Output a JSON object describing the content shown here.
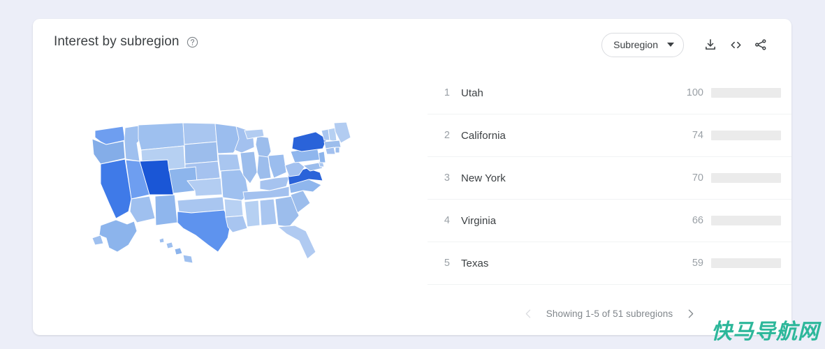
{
  "card": {
    "title": "Interest by subregion",
    "help_icon": "help-circle-icon"
  },
  "header": {
    "region_select_label": "Subregion",
    "caret_icon": "chevron-down-icon",
    "download_icon": "download-icon",
    "embed_icon": "embed-code-icon",
    "share_icon": "share-icon"
  },
  "colors": {
    "bar_fill": "#4e8cf0",
    "bar_track": "#ebebeb",
    "page_background": "#eceef8",
    "card_background": "#ffffff",
    "map_max": "#1a56d6",
    "map_min": "#c6d8f7",
    "watermark": "#2cb79a"
  },
  "chart_data": {
    "type": "bar",
    "title": "Interest by subregion",
    "xlabel": "",
    "ylabel": "",
    "ylim": [
      0,
      100
    ],
    "categories": [
      "Utah",
      "California",
      "New York",
      "Virginia",
      "Texas"
    ],
    "values": [
      100,
      74,
      70,
      66,
      59
    ],
    "ranks": [
      1,
      2,
      3,
      4,
      5
    ],
    "grid": false,
    "legend": "none",
    "note": "Horizontal ranked bar list, values normalized 0-100"
  },
  "list": {
    "rows": [
      {
        "rank": "1",
        "name": "Utah",
        "value": "100",
        "pct": 100
      },
      {
        "rank": "2",
        "name": "California",
        "value": "74",
        "pct": 74
      },
      {
        "rank": "3",
        "name": "New York",
        "value": "70",
        "pct": 70
      },
      {
        "rank": "4",
        "name": "Virginia",
        "value": "66",
        "pct": 66
      },
      {
        "rank": "5",
        "name": "Texas",
        "value": "59",
        "pct": 59
      }
    ]
  },
  "pagination": {
    "prev_icon": "chevron-left-icon",
    "next_icon": "chevron-right-icon",
    "status": "Showing 1-5 of 51 subregions"
  },
  "watermark": {
    "text": "快马导航网"
  }
}
